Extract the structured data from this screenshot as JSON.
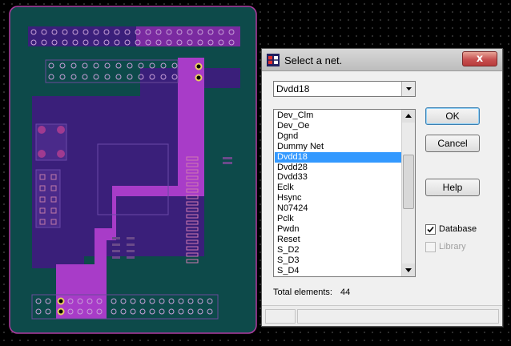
{
  "dialog": {
    "title": "Select a net.",
    "close_glyph": "x",
    "combo_value": "Dvdd18",
    "nets": [
      "Dev_Clm",
      "Dev_Oe",
      "Dgnd",
      "Dummy Net",
      "Dvdd18",
      "Dvdd28",
      "Dvdd33",
      "Eclk",
      "Hsync",
      "N07424",
      "Pclk",
      "Pwdn",
      "Reset",
      "S_D2",
      "S_D3",
      "S_D4"
    ],
    "selected_net": "Dvdd18",
    "buttons": {
      "ok": "OK",
      "cancel": "Cancel",
      "help": "Help"
    },
    "checkboxes": [
      {
        "label": "Database",
        "checked": true,
        "enabled": true
      },
      {
        "label": "Library",
        "checked": false,
        "enabled": false
      }
    ],
    "total_label": "Total elements:",
    "total_value": "44"
  },
  "icons": {
    "app": "app-icon",
    "combo_arrow": "chevron-down-icon",
    "scroll_up": "arrow-up-icon",
    "scroll_down": "arrow-down-icon",
    "check": "check-icon"
  },
  "colors": {
    "canvas": "#000000",
    "board_fill": "#0d4a4a",
    "board_outline": "#b03aa0",
    "copper_dark": "#3a1f7a",
    "copper_highlight": "#a83cc8",
    "selection": "#3399ff"
  }
}
